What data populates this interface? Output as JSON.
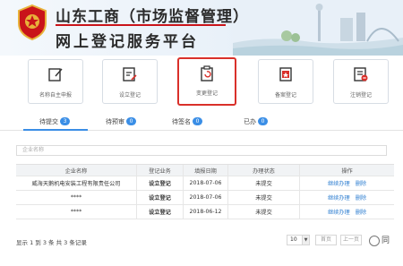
{
  "header": {
    "title_top": "山东工商（市场监督管理）",
    "title_bottom": "网上登记服务平台"
  },
  "tiles": [
    {
      "label": "名称自主申报",
      "icon": "edit-name-icon"
    },
    {
      "label": "设立登记",
      "icon": "establish-icon"
    },
    {
      "label": "变更登记",
      "icon": "change-icon",
      "selected": true
    },
    {
      "label": "备案登记",
      "icon": "filing-icon"
    },
    {
      "label": "注销登记",
      "icon": "cancel-icon"
    }
  ],
  "tabs": [
    {
      "label": "待提交",
      "badge": "3"
    },
    {
      "label": "待预审",
      "badge": "0"
    },
    {
      "label": "待签名",
      "badge": "0"
    },
    {
      "label": "已办",
      "badge": "0"
    }
  ],
  "search": {
    "placeholder": "企业名称"
  },
  "table": {
    "headers": [
      "企业名称",
      "登记业务",
      "填报日期",
      "办理状态",
      "操作"
    ],
    "rows": [
      {
        "name": "威海天鹅机电安装工程有限责任公司",
        "business": "设立登记",
        "date": "2018-07-06",
        "status": "未提交",
        "action1": "继续办理",
        "action2": "删除"
      },
      {
        "name": "****",
        "business": "设立登记",
        "date": "2018-07-06",
        "status": "未提交",
        "action1": "继续办理",
        "action2": "删除"
      },
      {
        "name": "****",
        "business": "设立登记",
        "date": "2018-06-12",
        "status": "未提交",
        "action1": "继续办理",
        "action2": "删除"
      }
    ]
  },
  "footer": {
    "summary": "显示 1 到 3 条 共 3 条记录",
    "page_size": "10",
    "first": "首页",
    "prev": "上一页"
  },
  "watermark": "同",
  "colors": {
    "accent": "#3a8ee6",
    "selected_border": "#d9302a",
    "brand_red": "#c9141a",
    "link": "#2f7fd1"
  }
}
